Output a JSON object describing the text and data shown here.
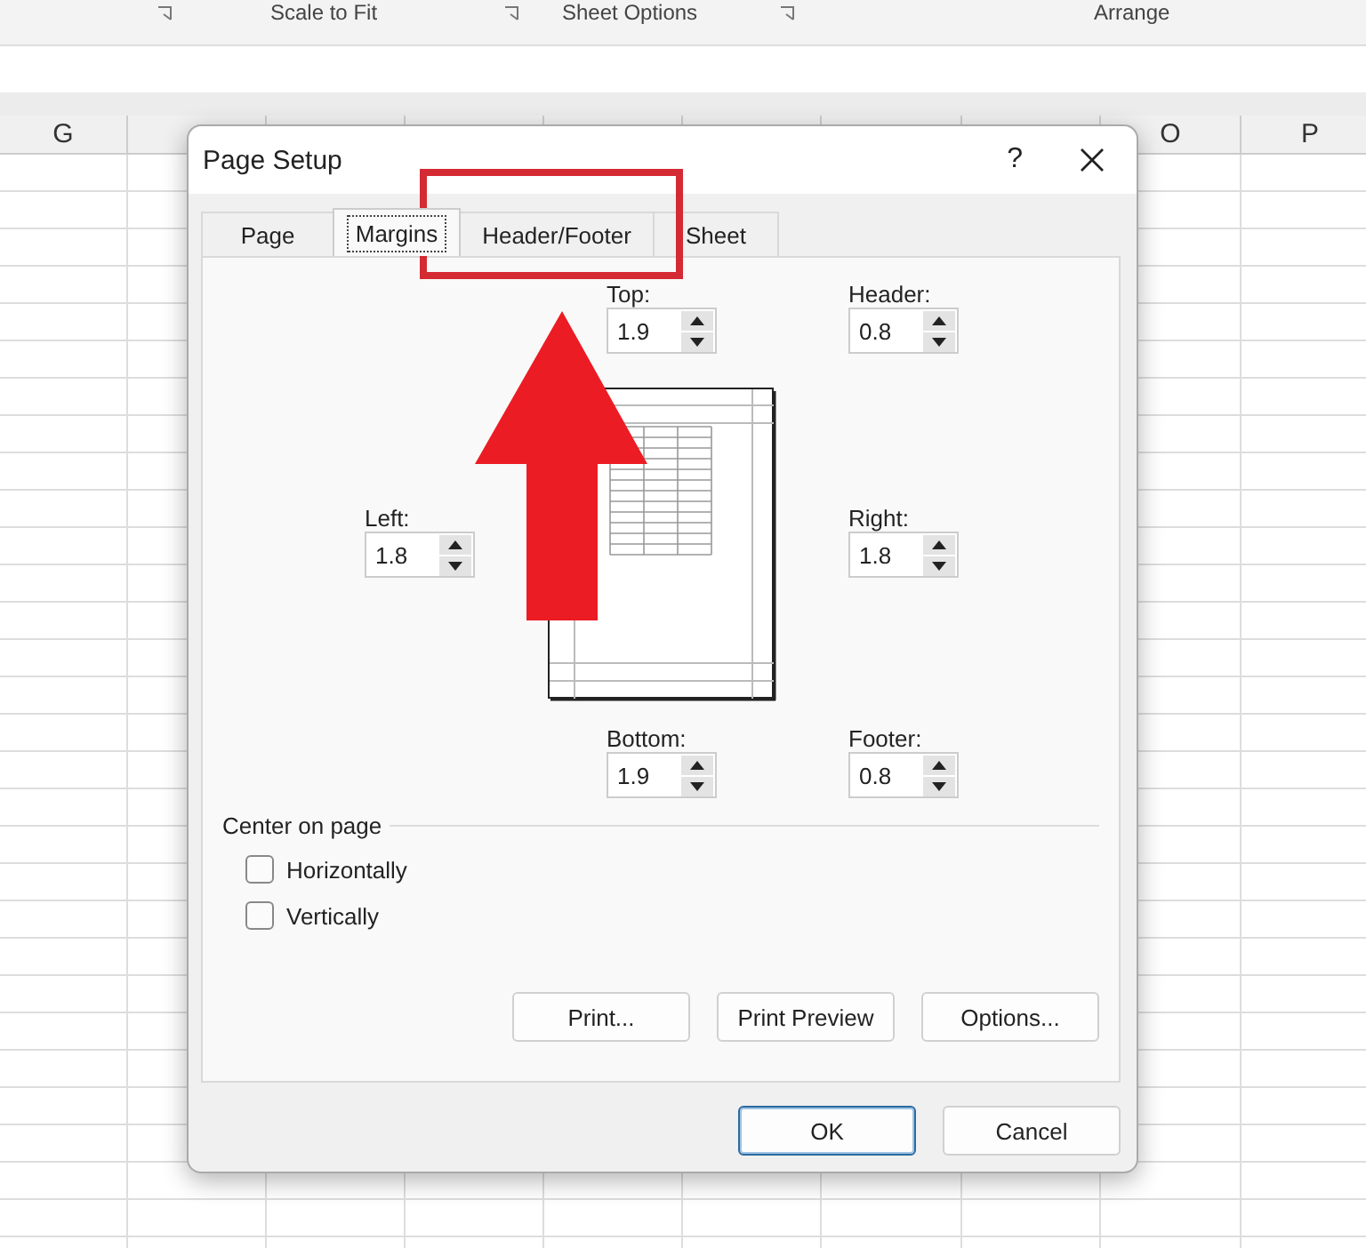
{
  "ribbon": {
    "groups": [
      {
        "label": "Scale to Fit"
      },
      {
        "label": "Sheet Options"
      },
      {
        "label": "Arrange"
      }
    ]
  },
  "sheet": {
    "columns": [
      {
        "label": "G"
      },
      {
        "label": "O"
      },
      {
        "label": "P"
      }
    ]
  },
  "dialog": {
    "title": "Page Setup",
    "help": "?",
    "tabs": [
      {
        "label": "Page",
        "selected": false
      },
      {
        "label": "Margins",
        "selected": true
      },
      {
        "label": "Header/Footer",
        "selected": false
      },
      {
        "label": "Sheet",
        "selected": false
      }
    ],
    "margins": {
      "top": {
        "label": "Top:",
        "value": "1.9"
      },
      "header": {
        "label": "Header:",
        "value": "0.8"
      },
      "left": {
        "label": "Left:",
        "value": "1.8"
      },
      "right": {
        "label": "Right:",
        "value": "1.8"
      },
      "bottom": {
        "label": "Bottom:",
        "value": "1.9"
      },
      "footer": {
        "label": "Footer:",
        "value": "0.8"
      }
    },
    "center_on_page": {
      "title": "Center on page",
      "options": [
        {
          "label": "Horizontally",
          "checked": false
        },
        {
          "label": "Vertically",
          "checked": false
        }
      ]
    },
    "panel_buttons": [
      {
        "label": "Print..."
      },
      {
        "label": "Print Preview"
      },
      {
        "label": "Options..."
      }
    ],
    "buttons": [
      {
        "label": "OK",
        "default": true
      },
      {
        "label": "Cancel",
        "default": false
      }
    ]
  }
}
